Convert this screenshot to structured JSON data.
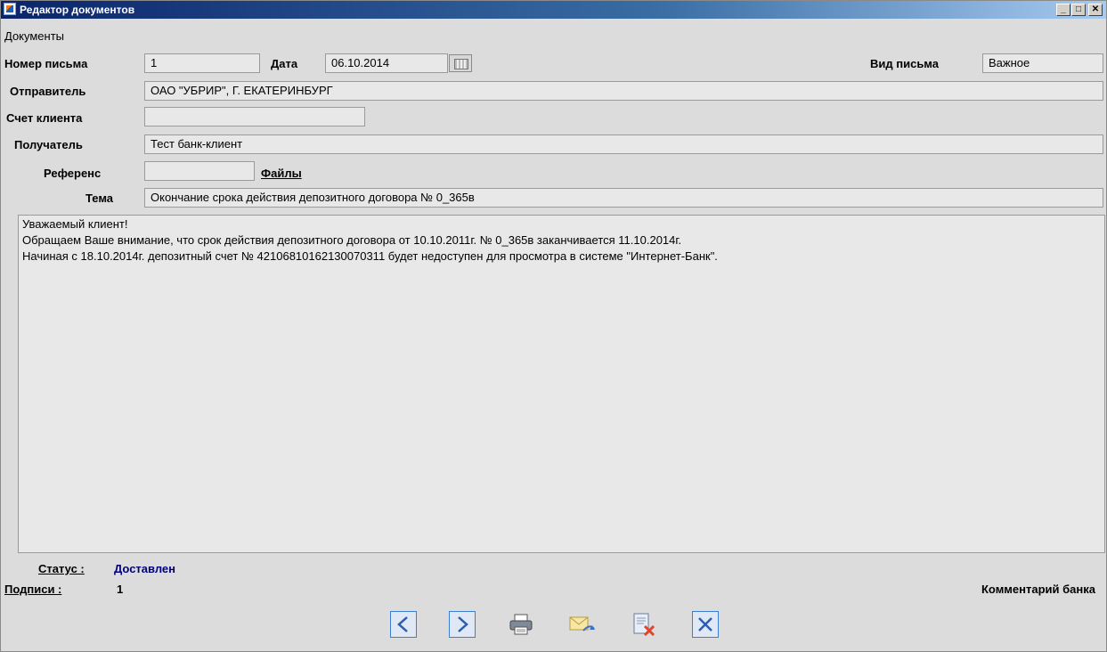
{
  "window": {
    "title": "Редактор документов",
    "controls": {
      "minimize": "_",
      "maximize": "□",
      "close": "✕"
    }
  },
  "menu": {
    "documents": "Документы"
  },
  "form": {
    "letter_number": {
      "label": "Номер письма",
      "value": "1"
    },
    "date": {
      "label": "Дата",
      "value": "06.10.2014"
    },
    "letter_type": {
      "label": "Вид письма",
      "value": "Важное"
    },
    "sender": {
      "label": "Отправитель",
      "value": "ОАО \"УБРИР\", Г. ЕКАТЕРИНБУРГ"
    },
    "client_account": {
      "label": "Счет клиента",
      "value": ""
    },
    "recipient": {
      "label": "Получатель",
      "value": "Тест банк-клиент"
    },
    "reference": {
      "label": "Референс",
      "value": ""
    },
    "files_link": "Файлы",
    "subject": {
      "label": "Тема",
      "value": "Окончание срока действия депозитного договора № 0_365в"
    }
  },
  "body": {
    "lines": [
      "Уважаемый клиент!",
      "Обращаем Ваше внимание, что срок действия депозитного договора от 10.10.2011г. № 0_365в заканчивается 11.10.2014г.",
      "Начиная с 18.10.2014г. депозитный счет № 42106810162130070311 будет недоступен для просмотра в системе \"Интернет-Банк\"."
    ]
  },
  "footer": {
    "status_label": "Статус :",
    "status_value": "Доставлен",
    "signatures_label": "Подписи :",
    "signatures_value": "1",
    "bank_comment": "Комментарий банка"
  },
  "toolbar": {
    "icons": [
      "chevron-left-icon",
      "chevron-right-icon",
      "printer-icon",
      "envelope-reply-icon",
      "document-delete-icon",
      "close-icon"
    ]
  },
  "colors": {
    "titlebar": "#0a246a",
    "status": "#00007a",
    "nav_button_border": "#3b7fd0"
  }
}
